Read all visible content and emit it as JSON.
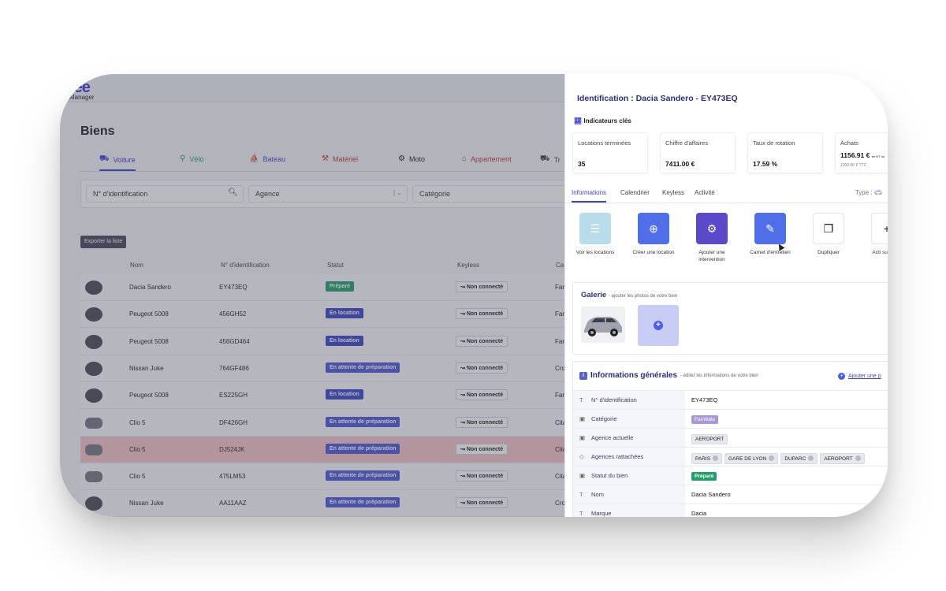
{
  "app": {
    "logo_main": "tee",
    "logo_sub": "Manager",
    "page_title": "Biens"
  },
  "category_tabs": [
    {
      "label": "Voiture",
      "icon": "car-icon",
      "color": "#3b3fd8"
    },
    {
      "label": "Vélo",
      "icon": "bike-icon",
      "color": "#22a06b"
    },
    {
      "label": "Bateau",
      "icon": "boat-icon",
      "color": "#3b46c8"
    },
    {
      "label": "Matériel",
      "icon": "tools-icon",
      "color": "#c0392b"
    },
    {
      "label": "Moto",
      "icon": "moto-icon",
      "color": "#222222"
    },
    {
      "label": "Appartement",
      "icon": "house-icon",
      "color": "#c0392b"
    },
    {
      "label": "Tr",
      "icon": "truck-icon",
      "color": "#444444"
    }
  ],
  "filters": {
    "id_placeholder": "N° d'identification",
    "agency_placeholder": "Agence",
    "category_placeholder": "Catégorie"
  },
  "export_label": "Exporter la liste",
  "table": {
    "headers": [
      "Nom",
      "N° d'identification",
      "Statut",
      "Keyless",
      "Ca"
    ],
    "keyless_label": "Non connecté",
    "rows": [
      {
        "name": "Dacia Sandero",
        "id": "EY473EQ",
        "status": "Préparé",
        "status_type": "green",
        "cat": "Fam"
      },
      {
        "name": "Peugeot 5008",
        "id": "456GH52",
        "status": "En location",
        "status_type": "blue",
        "cat": "Fam"
      },
      {
        "name": "Peugeot 5008",
        "id": "456GD464",
        "status": "En location",
        "status_type": "blue",
        "cat": "Fam"
      },
      {
        "name": "Nissan Juke",
        "id": "764GF486",
        "status": "En attente de préparation",
        "status_type": "indigo",
        "cat": "Cro"
      },
      {
        "name": "Peugeot 5008",
        "id": "ES225GH",
        "status": "En location",
        "status_type": "blue",
        "cat": "Fam"
      },
      {
        "name": "Clio 5",
        "id": "DF426GH",
        "status": "En attente de préparation",
        "status_type": "indigo",
        "cat": "Cita"
      },
      {
        "name": "Clio 5",
        "id": "DJ524JK",
        "status": "En attente de préparation",
        "status_type": "indigo",
        "cat": "Cita"
      },
      {
        "name": "Clio 5",
        "id": "475LM53",
        "status": "En attente de préparation",
        "status_type": "indigo",
        "cat": "Cita"
      },
      {
        "name": "Nissan Juke",
        "id": "AA11AAZ",
        "status": "En attente de préparation",
        "status_type": "indigo",
        "cat": "Cro"
      }
    ]
  },
  "panel": {
    "title": "Identification : Dacia Sandero - EY473EQ",
    "indicators_label": "Indicateurs clés",
    "kpis": [
      {
        "label": "Locations terminées",
        "value": "35"
      },
      {
        "label": "Chiffre d'affaires",
        "value": "7411.00 €"
      },
      {
        "label": "Taux de rotation",
        "value": "17.59 %"
      },
      {
        "label": "Achats",
        "value": "1156.91 €",
        "value_note": "en HT ou",
        "sub": "1300.00 € TTC"
      }
    ],
    "tabs": [
      "Informations",
      "Calendrier",
      "Keyless",
      "Activité"
    ],
    "type_label": "Type :",
    "actions": [
      {
        "label": "Voir les locations",
        "color": "#b9dcea",
        "icon": "list-icon",
        "glyph": "☰"
      },
      {
        "label": "Créer une location",
        "color": "#4f6ee8",
        "icon": "plus-circle-icon",
        "glyph": "⊕"
      },
      {
        "label": "Ajouter une intervention",
        "color": "#5a49c8",
        "icon": "intervention-icon",
        "glyph": "⚙"
      },
      {
        "label": "Carnet d'entretien",
        "color": "#4f6ee8",
        "icon": "logbook-icon",
        "glyph": "✎"
      },
      {
        "label": "Dupliquer",
        "color": "#ffffff",
        "icon": "duplicate-icon",
        "glyph": "❐"
      },
      {
        "label": "Acti supplém",
        "color": "#ffffff",
        "icon": "more-icon",
        "glyph": "+"
      }
    ],
    "gallery": {
      "title": "Galerie",
      "subtitle": "- ajouter les photos de votre bien"
    },
    "info": {
      "title": "Informations générales",
      "subtitle": "- éditer les informations de votre bien",
      "link": "Ajouter une p",
      "rows": [
        {
          "icon": "text-icon",
          "glyph": "T",
          "key": "N° d'identification",
          "value": "EY473EQ"
        },
        {
          "icon": "select-icon",
          "glyph": "▣",
          "key": "Catégorie",
          "chips": [
            "Familiale"
          ],
          "chip_type": "purple"
        },
        {
          "icon": "select-icon",
          "glyph": "▣",
          "key": "Agence actuelle",
          "chips": [
            "AEROPORT"
          ],
          "chip_type": "gray"
        },
        {
          "icon": "tag-icon",
          "glyph": "◇",
          "key": "Agences rattachées",
          "chips": [
            "PARIS",
            "GARE DE LYON",
            "DUPARC",
            "AEROPORT"
          ],
          "chip_type": "gray-x"
        },
        {
          "icon": "select-icon",
          "glyph": "▣",
          "key": "Statut du bien",
          "chips": [
            "Préparé"
          ],
          "chip_type": "green"
        },
        {
          "icon": "text-icon",
          "glyph": "T",
          "key": "Nom",
          "value": "Dacia Sandero"
        },
        {
          "icon": "text-icon",
          "glyph": "T",
          "key": "Marque",
          "value": "Dacia"
        }
      ]
    }
  }
}
